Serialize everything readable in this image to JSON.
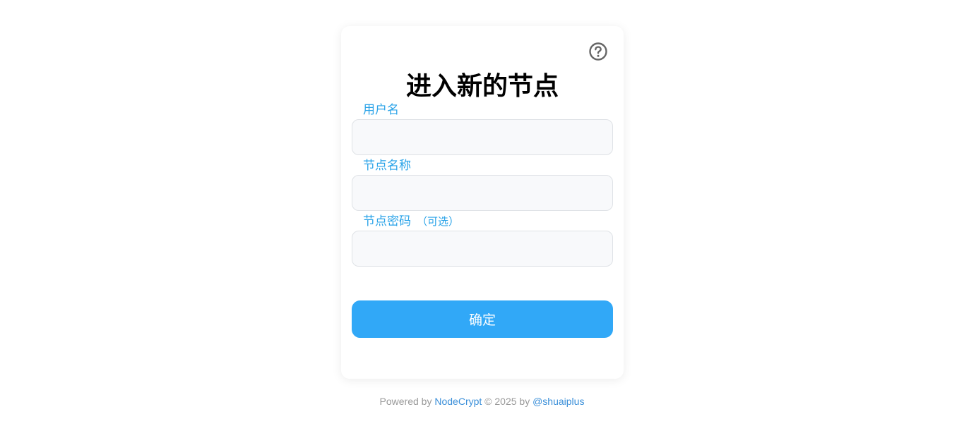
{
  "login_card": {
    "title": "进入新的节点",
    "help_icon": "question-circle-icon",
    "fields": [
      {
        "label": "用户名",
        "value": "",
        "placeholder": ""
      },
      {
        "label": "节点名称",
        "value": "",
        "placeholder": ""
      },
      {
        "label": "节点密码",
        "hint": "（可选）",
        "value": "",
        "placeholder": ""
      }
    ],
    "confirm_label": "确定"
  },
  "footer": {
    "powered_by": "Powered by",
    "project_link": "NodeCrypt",
    "copyright": "© 2025 by",
    "author_link": "@shuaiplus"
  },
  "colors": {
    "accent": "#31a8f7",
    "label": "#2aa3e8",
    "link": "#3a8fd9",
    "footer_text": "#999999"
  }
}
